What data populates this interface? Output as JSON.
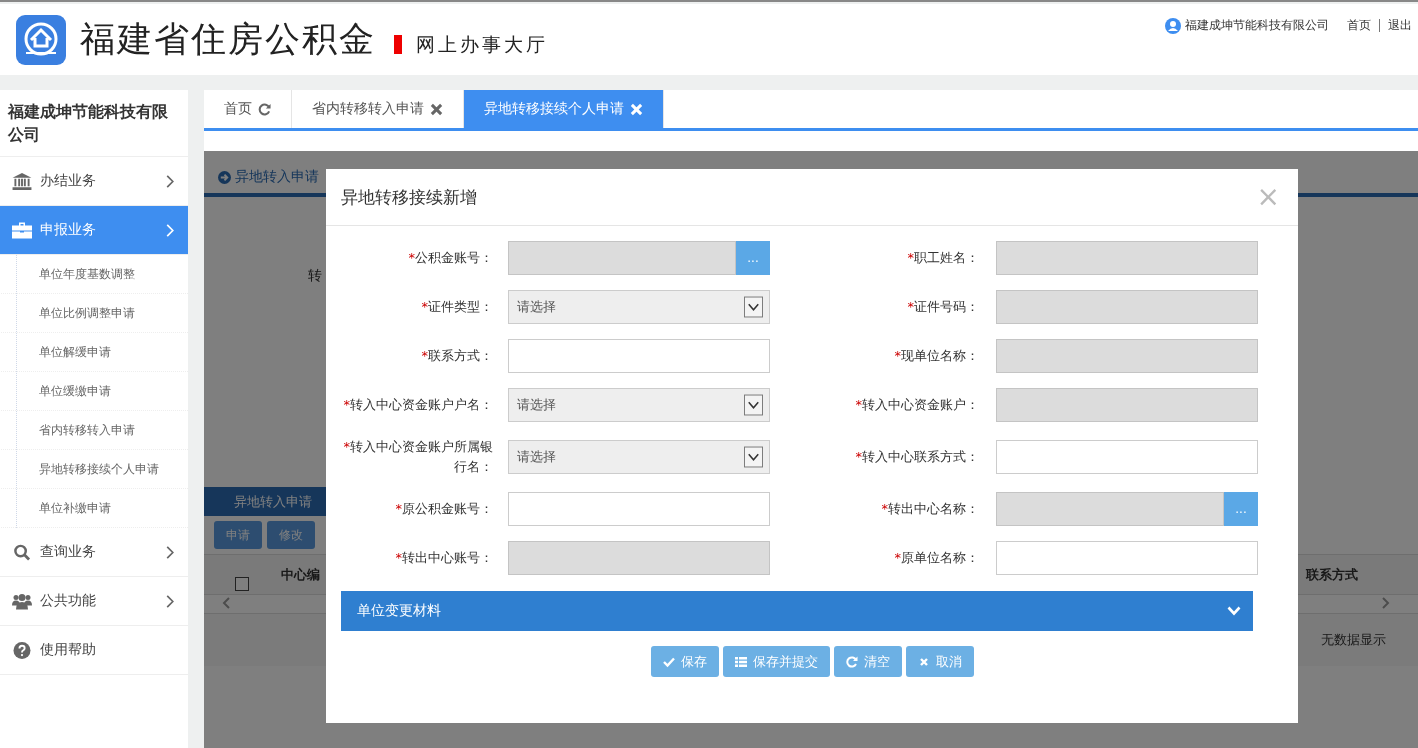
{
  "header": {
    "title": "福建省住房公积金",
    "subtitle": "网上办事大厅",
    "user": "福建成坤节能科技有限公司",
    "links": [
      "首页",
      "退出"
    ]
  },
  "sidebar": {
    "company": "福建成坤节能科技有限公司",
    "items": [
      {
        "label": "办结业务",
        "kind": "bank",
        "selected": false
      },
      {
        "label": "申报业务",
        "kind": "briefcase",
        "selected": true,
        "children": [
          {
            "label": "单位年度基数调整"
          },
          {
            "label": "单位比例调整申请"
          },
          {
            "label": "单位解缓申请"
          },
          {
            "label": "单位缓缴申请"
          },
          {
            "label": "省内转移转入申请"
          },
          {
            "label": "异地转移接续个人申请"
          },
          {
            "label": "单位补缴申请"
          }
        ]
      },
      {
        "label": "查询业务",
        "kind": "search",
        "selected": false
      },
      {
        "label": "公共功能",
        "kind": "users",
        "selected": false
      },
      {
        "label": "使用帮助",
        "kind": "help",
        "selected": false
      }
    ]
  },
  "tabs": [
    {
      "label": "首页",
      "kind": "refresh",
      "selected": false
    },
    {
      "label": "省内转移转入申请",
      "kind": "close",
      "selected": false
    },
    {
      "label": "异地转移接续个人申请",
      "kind": "close",
      "selected": true
    }
  ],
  "background": {
    "panel_title": "异地转入申请",
    "field_label": "转",
    "grid_title": "异地转入申请",
    "toolbar": [
      "申请",
      "修改"
    ],
    "select_all": {
      "checked": false
    },
    "columns": [
      "中心编",
      "联系方式"
    ],
    "empty": "无数据显示"
  },
  "dialog": {
    "title": "异地转移接续新增",
    "close": "×",
    "rows": [
      [
        {
          "mark": "*",
          "label": "公积金账号：",
          "kind": "lookup",
          "disabled": true,
          "button": "..."
        },
        {
          "mark": "*",
          "label": "职工姓名：",
          "kind": "input",
          "disabled": true
        }
      ],
      [
        {
          "mark": "*",
          "label": "证件类型：",
          "kind": "select",
          "disabled": true,
          "placeholder": "请选择"
        },
        {
          "mark": "*",
          "label": "证件号码：",
          "kind": "input",
          "disabled": true
        }
      ],
      [
        {
          "mark": "*",
          "label": "联系方式：",
          "kind": "input",
          "disabled": false
        },
        {
          "mark": "*",
          "label": "现单位名称：",
          "kind": "input",
          "disabled": true
        }
      ],
      [
        {
          "mark": "*",
          "label": "转入中心资金账户户名：",
          "kind": "select",
          "disabled": true,
          "placeholder": "请选择"
        },
        {
          "mark": "*",
          "label": "转入中心资金账户：",
          "kind": "input",
          "disabled": true
        }
      ],
      [
        {
          "mark": "*",
          "label": "转入中心资金账户所属银行名：",
          "kind": "select",
          "disabled": true,
          "placeholder": "请选择"
        },
        {
          "mark": "*",
          "label": "转入中心联系方式：",
          "kind": "input",
          "disabled": false
        }
      ],
      [
        {
          "mark": "*",
          "label": "原公积金账号：",
          "kind": "input",
          "disabled": false
        },
        {
          "mark": "*",
          "label": "转出中心名称：",
          "kind": "lookup",
          "disabled": true,
          "button": "..."
        }
      ],
      [
        {
          "mark": "*",
          "label": "转出中心账号：",
          "kind": "input",
          "disabled": true
        },
        {
          "mark": "*",
          "label": "原单位名称：",
          "kind": "input",
          "disabled": false
        }
      ]
    ],
    "section": {
      "label": "单位变更材料",
      "expanded": false
    },
    "buttons": [
      {
        "label": "保存",
        "kind": "check"
      },
      {
        "label": "保存并提交",
        "kind": "list"
      },
      {
        "label": "清空",
        "kind": "refresh"
      },
      {
        "label": "取消",
        "kind": "cross"
      }
    ]
  }
}
